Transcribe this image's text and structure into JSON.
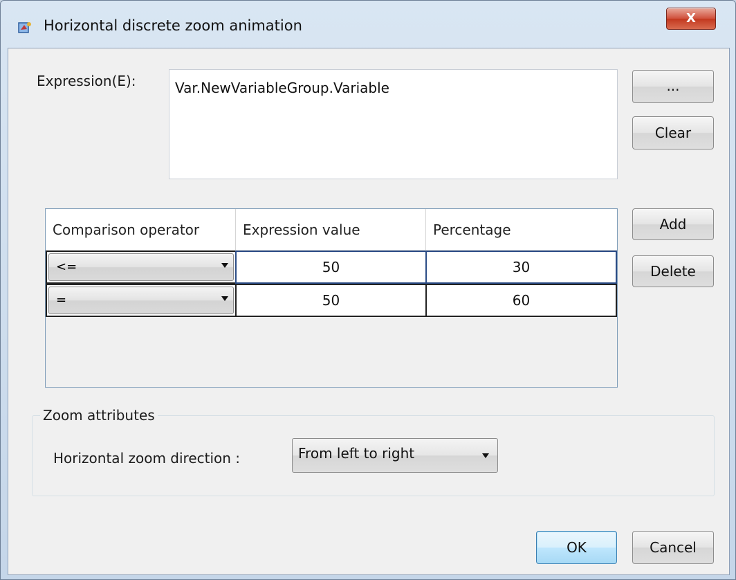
{
  "window": {
    "title": "Horizontal discrete zoom animation",
    "close_label": "X"
  },
  "expression": {
    "label": "Expression(E):",
    "value": "Var.NewVariableGroup.Variable",
    "browse_label": "...",
    "clear_label": "Clear"
  },
  "table": {
    "headers": [
      "Comparison operator",
      "Expression value",
      "Percentage"
    ],
    "rows": [
      {
        "operator": "<=",
        "value": "50",
        "percentage": "30"
      },
      {
        "operator": "=",
        "value": "50",
        "percentage": "60"
      }
    ],
    "add_label": "Add",
    "delete_label": "Delete"
  },
  "zoom": {
    "group_title": "Zoom attributes",
    "direction_label": "Horizontal zoom direction :",
    "direction_value": "From left to right"
  },
  "footer": {
    "ok_label": "OK",
    "cancel_label": "Cancel"
  }
}
